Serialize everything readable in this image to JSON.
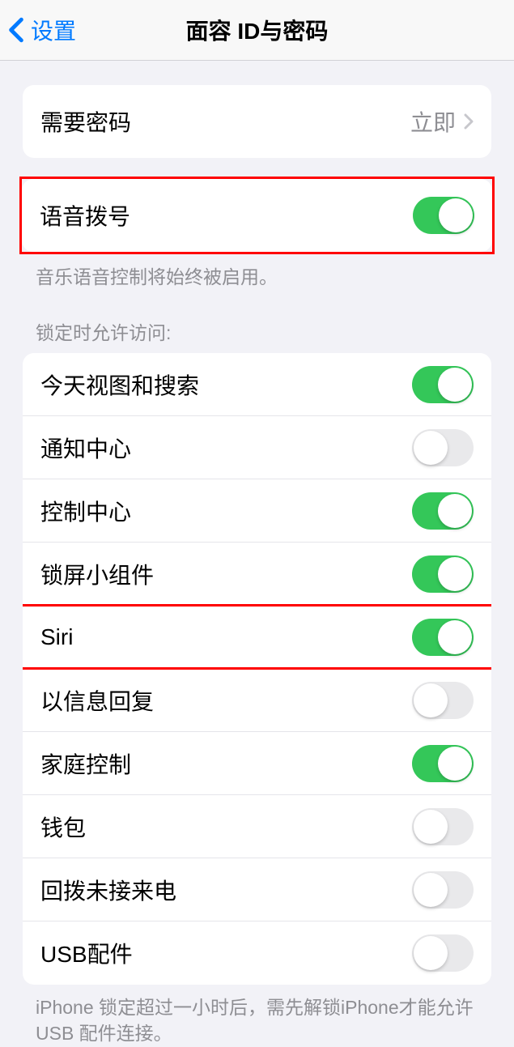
{
  "header": {
    "back_label": "设置",
    "title": "面容 ID与密码"
  },
  "require_passcode": {
    "label": "需要密码",
    "value": "立即"
  },
  "voice_dial": {
    "label": "语音拨号",
    "on": true,
    "footer": "音乐语音控制将始终被启用。"
  },
  "lock_section": {
    "header": "锁定时允许访问:",
    "items": [
      {
        "label": "今天视图和搜索",
        "on": true
      },
      {
        "label": "通知中心",
        "on": false
      },
      {
        "label": "控制中心",
        "on": true
      },
      {
        "label": "锁屏小组件",
        "on": true
      },
      {
        "label": "Siri",
        "on": true
      },
      {
        "label": "以信息回复",
        "on": false
      },
      {
        "label": "家庭控制",
        "on": true
      },
      {
        "label": "钱包",
        "on": false
      },
      {
        "label": "回拨未接来电",
        "on": false
      },
      {
        "label": "USB配件",
        "on": false
      }
    ],
    "footer": "iPhone 锁定超过一小时后，需先解锁iPhone才能允许USB 配件连接。"
  }
}
